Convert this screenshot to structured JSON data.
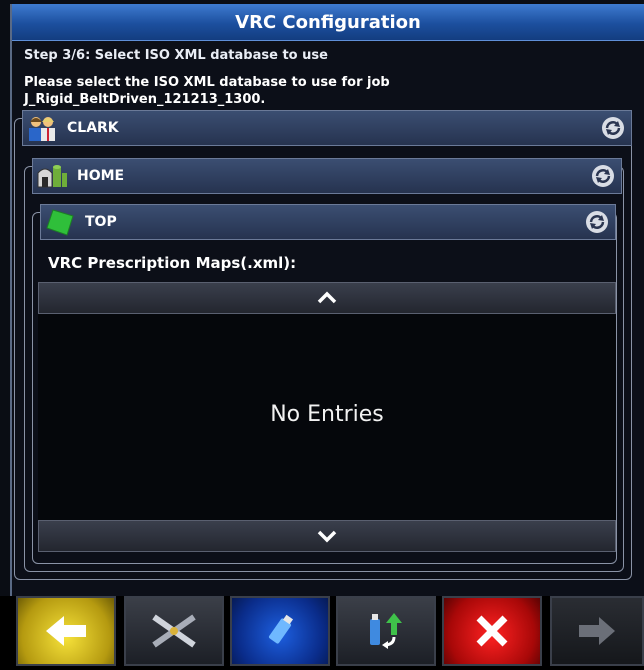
{
  "window": {
    "title": "VRC Configuration"
  },
  "wizard": {
    "step": "Step 3/6: Select ISO XML database to use",
    "instruction_line1": "Please select the ISO XML database to use for job",
    "instruction_line2": "J_Rigid_BeltDriven_121213_1300."
  },
  "tree": {
    "client": {
      "label": "CLARK",
      "icon": "people-icon"
    },
    "farm": {
      "label": "HOME",
      "icon": "farm-icon"
    },
    "field": {
      "label": "TOP",
      "icon": "field-icon"
    }
  },
  "maps": {
    "label": "VRC Prescription Maps(.xml):",
    "empty_text": "No Entries"
  },
  "toolbar": {
    "buttons": [
      "back-arrow-icon",
      "tools-icon",
      "usb-icon",
      "import-icon",
      "cancel-icon",
      "next-arrow-icon"
    ]
  },
  "colors": {
    "title_bar": "#1c4f9e",
    "header": "#2f3e5e",
    "back_button": "#f6e23a",
    "usb_button": "#1d5fe0",
    "cancel_button": "#e01010",
    "field_icon": "#2fbf3a"
  }
}
